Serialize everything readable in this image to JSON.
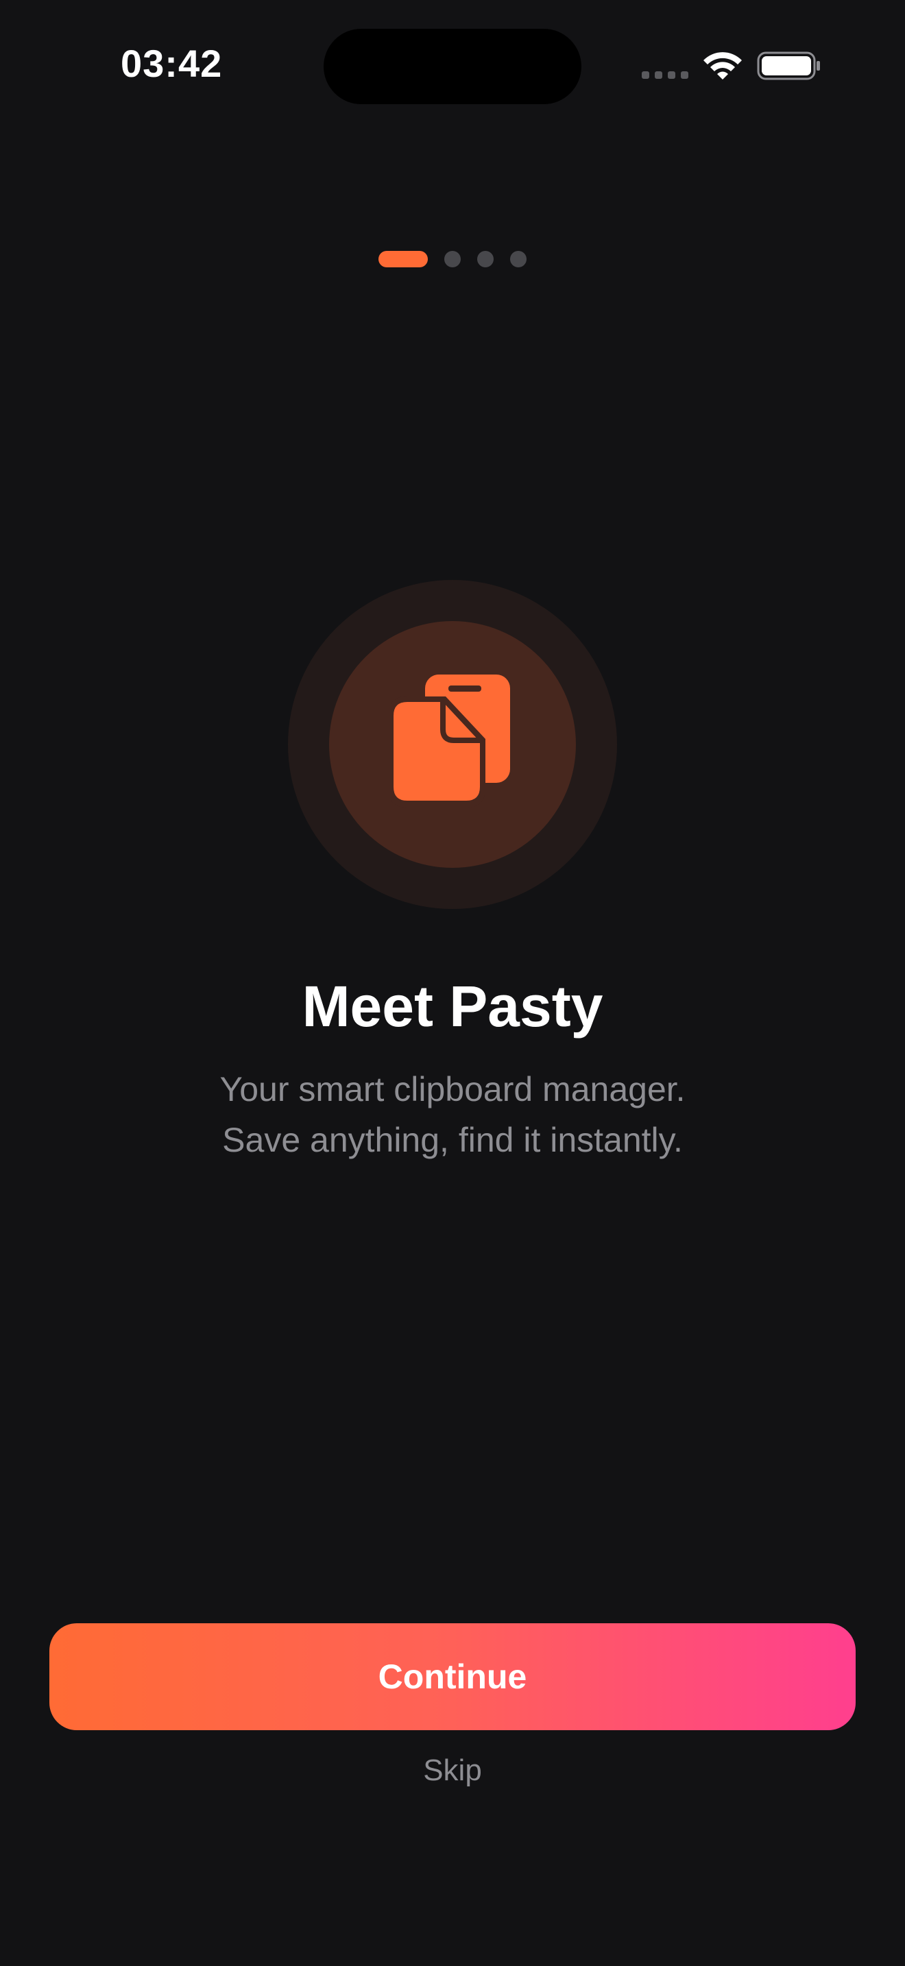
{
  "status_bar": {
    "time": "03:42"
  },
  "page_indicator": {
    "total": 4,
    "current": 1
  },
  "onboarding": {
    "icon": "clipboard-documents-icon",
    "title": "Meet Pasty",
    "subtitle_line1": "Your smart clipboard manager.",
    "subtitle_line2": "Save anything, find it instantly."
  },
  "actions": {
    "continue_label": "Continue",
    "skip_label": "Skip"
  },
  "colors": {
    "background": "#121214",
    "accent": "#ff6b35",
    "gradient_end": "#ff3f8e",
    "secondary_text": "#8e8e93"
  }
}
